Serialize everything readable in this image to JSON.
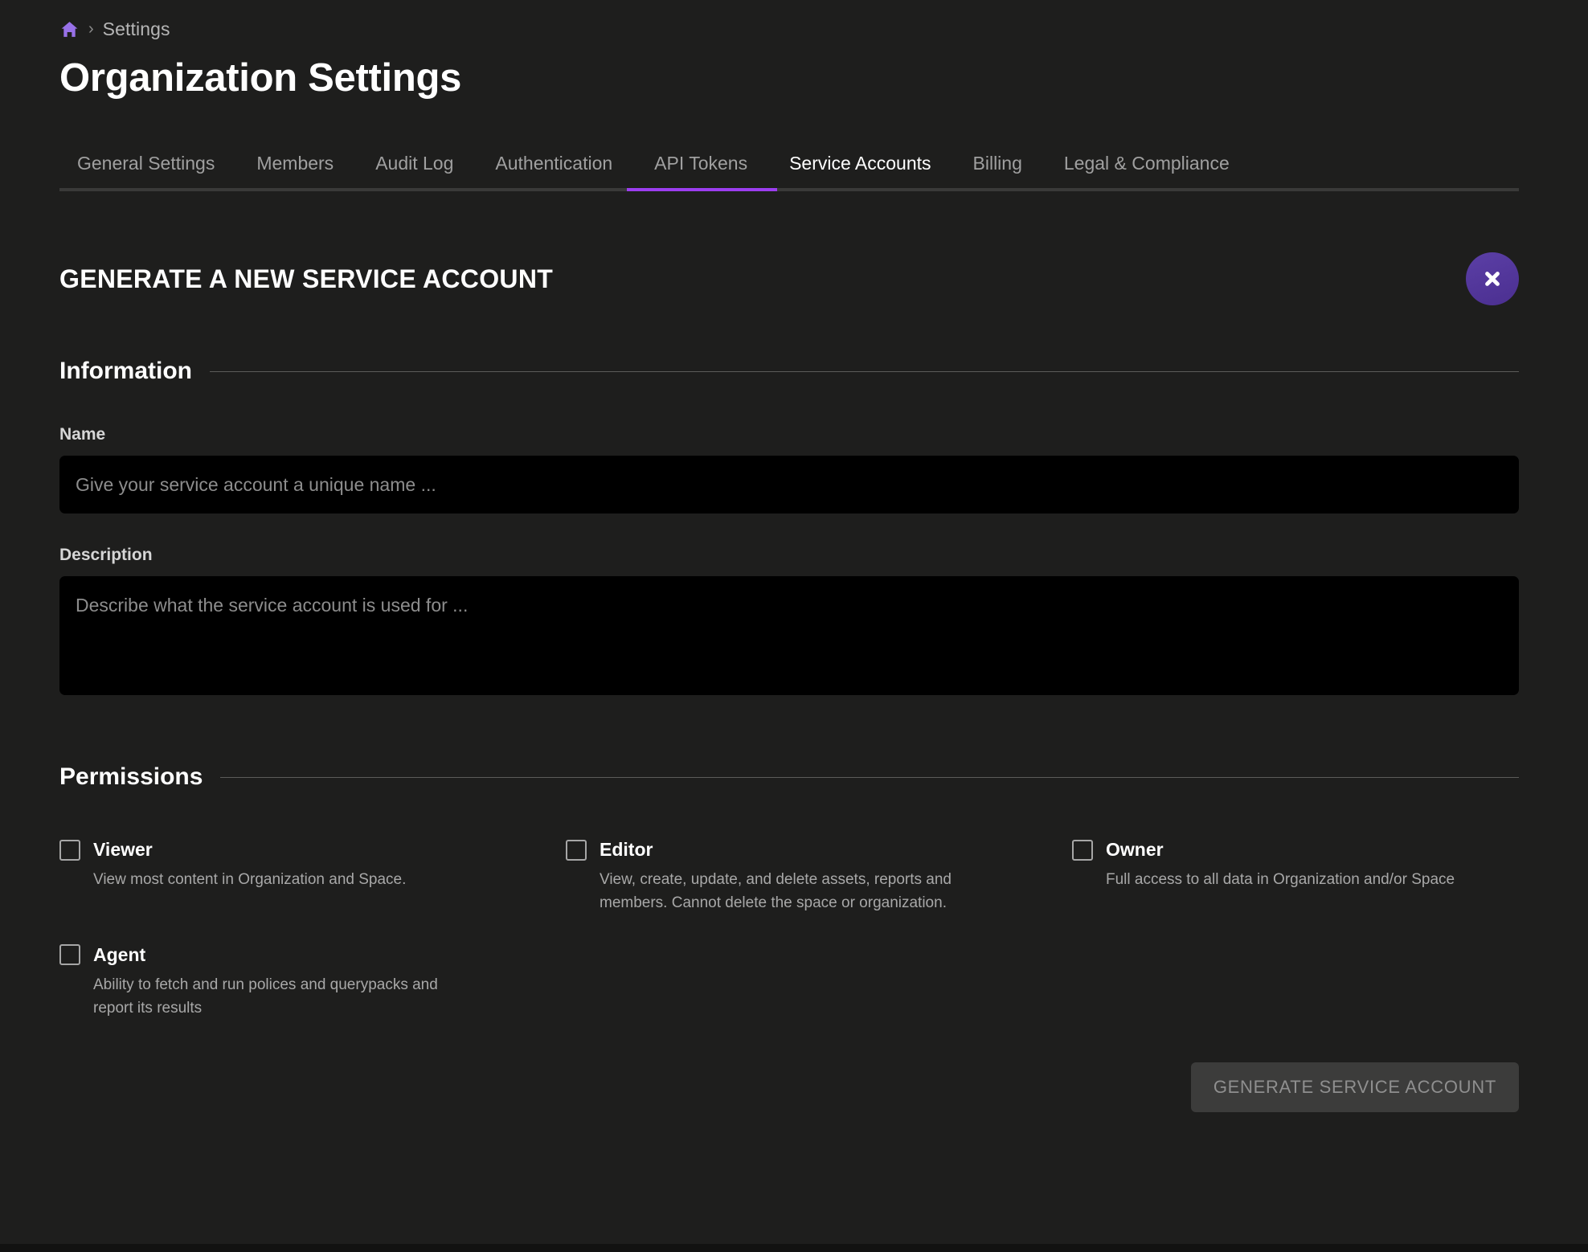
{
  "breadcrumb": {
    "home_icon": "home-icon",
    "separator": "›",
    "items": [
      {
        "label": "Settings"
      }
    ]
  },
  "header": {
    "title": "Organization Settings"
  },
  "tabs": {
    "items": [
      {
        "label": "General Settings",
        "active": false
      },
      {
        "label": "Members",
        "active": false
      },
      {
        "label": "Audit Log",
        "active": false
      },
      {
        "label": "Authentication",
        "active": false
      },
      {
        "label": "API Tokens",
        "active": false
      },
      {
        "label": "Service Accounts",
        "active": true
      },
      {
        "label": "Billing",
        "active": false
      },
      {
        "label": "Legal & Compliance",
        "active": false
      }
    ],
    "active_index": 5,
    "active_color": "#9c3ef0"
  },
  "panel": {
    "title": "GENERATE A NEW SERVICE ACCOUNT",
    "close_icon": "close-icon",
    "close_color": "#54369b"
  },
  "information": {
    "section_title": "Information",
    "name": {
      "label": "Name",
      "placeholder": "Give your service account a unique name ...",
      "value": ""
    },
    "description": {
      "label": "Description",
      "placeholder": "Describe what the service account is used for ...",
      "value": ""
    }
  },
  "permissions": {
    "section_title": "Permissions",
    "items": [
      {
        "name": "Viewer",
        "description": "View most content in Organization and Space.",
        "checked": false
      },
      {
        "name": "Editor",
        "description": "View, create, update, and delete assets, reports and members. Cannot delete the space or organization.",
        "checked": false
      },
      {
        "name": "Owner",
        "description": "Full access to all data in Organization and/or Space",
        "checked": false
      },
      {
        "name": "Agent",
        "description": "Ability to fetch and run polices and querypacks and report its results",
        "checked": false
      }
    ]
  },
  "footer": {
    "generate_label": "GENERATE SERVICE ACCOUNT",
    "generate_disabled": true
  },
  "theme": {
    "background": "#1e1e1d",
    "input_background": "#000000",
    "accent": "#9c3ef0",
    "home_icon_color": "#9871e8"
  }
}
